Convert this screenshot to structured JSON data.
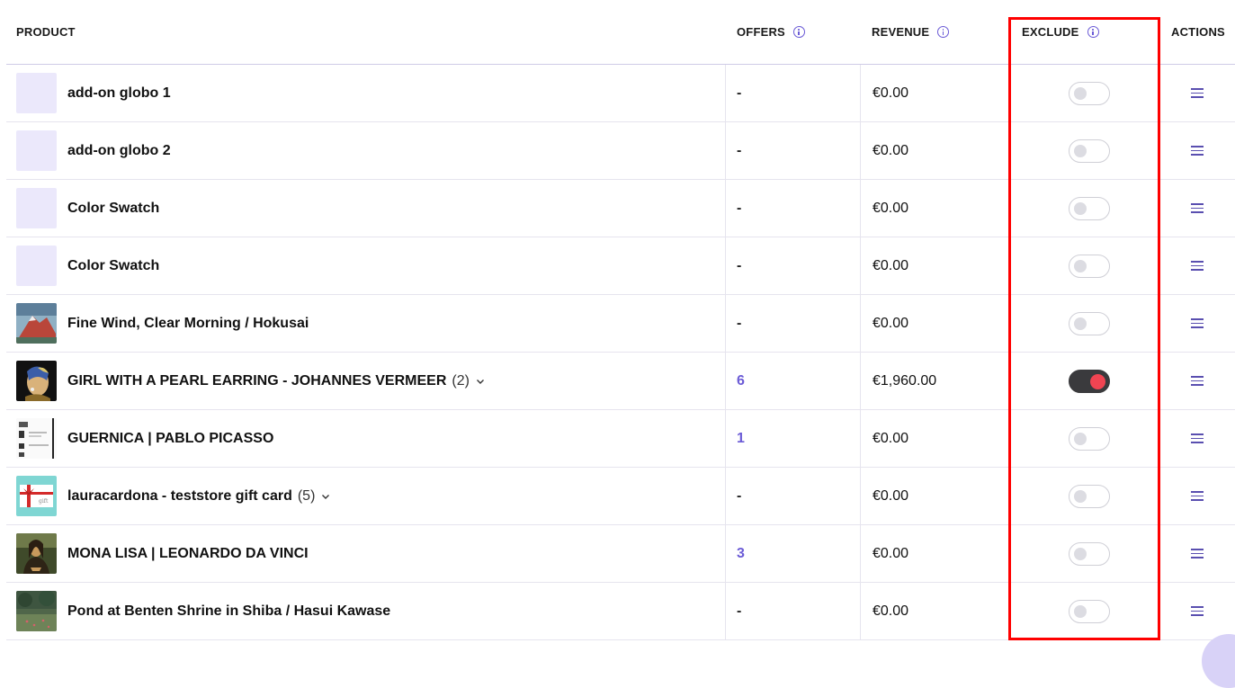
{
  "columns": {
    "product": "PRODUCT",
    "offers": "OFFERS",
    "revenue": "REVENUE",
    "exclude": "EXCLUDE",
    "actions": "ACTIONS"
  },
  "rows": [
    {
      "name": "add-on globo 1",
      "count": "",
      "offers": "-",
      "revenue": "€0.00",
      "thumb": "placeholder",
      "excluded": false
    },
    {
      "name": "add-on globo 2",
      "count": "",
      "offers": "-",
      "revenue": "€0.00",
      "thumb": "placeholder",
      "excluded": false
    },
    {
      "name": "Color Swatch",
      "count": "",
      "offers": "-",
      "revenue": "€0.00",
      "thumb": "placeholder",
      "excluded": false
    },
    {
      "name": "Color Swatch",
      "count": "",
      "offers": "-",
      "revenue": "€0.00",
      "thumb": "placeholder",
      "excluded": false
    },
    {
      "name": "Fine Wind, Clear Morning / Hokusai",
      "count": "",
      "offers": "-",
      "revenue": "€0.00",
      "thumb": "hokusai",
      "excluded": false
    },
    {
      "name": "GIRL WITH A PEARL EARRING - JOHANNES VERMEER",
      "count": "(2)",
      "offers": "6",
      "revenue": "€1,960.00",
      "thumb": "vermeer",
      "excluded": true
    },
    {
      "name": "GUERNICA | PABLO PICASSO",
      "count": "",
      "offers": "1",
      "revenue": "€0.00",
      "thumb": "guernica",
      "excluded": false
    },
    {
      "name": "lauracardona - teststore gift card",
      "count": "(5)",
      "offers": "-",
      "revenue": "€0.00",
      "thumb": "giftcard",
      "excluded": false
    },
    {
      "name": "MONA LISA | LEONARDO DA VINCI",
      "count": "",
      "offers": "3",
      "revenue": "€0.00",
      "thumb": "monalisa",
      "excluded": false
    },
    {
      "name": "Pond at Benten Shrine in Shiba / Hasui Kawase",
      "count": "",
      "offers": "-",
      "revenue": "€0.00",
      "thumb": "pond",
      "excluded": false
    }
  ],
  "icons": {
    "info": "info-circle-icon",
    "chevron": "chevron-down-icon",
    "actions": "hamburger-menu-icon"
  },
  "colors": {
    "accent": "#6b5bd6",
    "toggle_on_track": "#3a3a3d",
    "toggle_on_knob": "#f04452",
    "highlight": "#ff0000",
    "placeholder_thumb": "#ebe8fb"
  }
}
